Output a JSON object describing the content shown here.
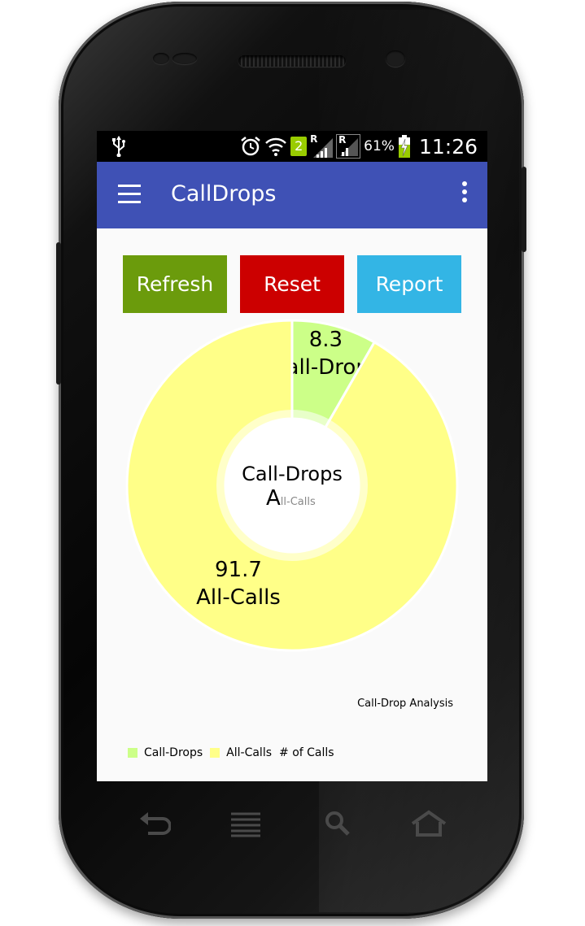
{
  "status_bar": {
    "icons": [
      "usb-icon",
      "alarm-icon",
      "wifi-icon",
      "sim2-icon",
      "signal-roaming-icon",
      "signal-icon",
      "battery-charging-icon"
    ],
    "sim_label": "2",
    "roaming_label": "R",
    "battery_percent": "61%",
    "time": "11:26"
  },
  "app_bar": {
    "title": "CallDrops",
    "color": "#3f51b5"
  },
  "buttons": {
    "refresh": "Refresh",
    "reset": "Reset",
    "report": "Report",
    "colors": {
      "refresh": "#6b9b0c",
      "reset": "#cc0000",
      "report": "#33b5e5"
    }
  },
  "chart_data": {
    "type": "pie",
    "style": "donut",
    "slices": [
      {
        "label": "Call-Drops",
        "value": 8.3,
        "value_text": "8.3",
        "color": "#ccff88"
      },
      {
        "label": "All-Calls",
        "value": 91.7,
        "value_text": "91.7",
        "color": "#ffff88"
      }
    ],
    "center_text": "Call-Drops",
    "center_subtext_large": "A",
    "center_subtext_small": "ll-Calls",
    "description": "Call-Drop Analysis",
    "legend": [
      "Call-Drops",
      "All-Calls"
    ],
    "legend_suffix": "# of Calls",
    "legend_position": "bottom-left"
  },
  "nav_keys": [
    "back-icon",
    "menu-lines-icon",
    "search-icon",
    "home-icon"
  ]
}
